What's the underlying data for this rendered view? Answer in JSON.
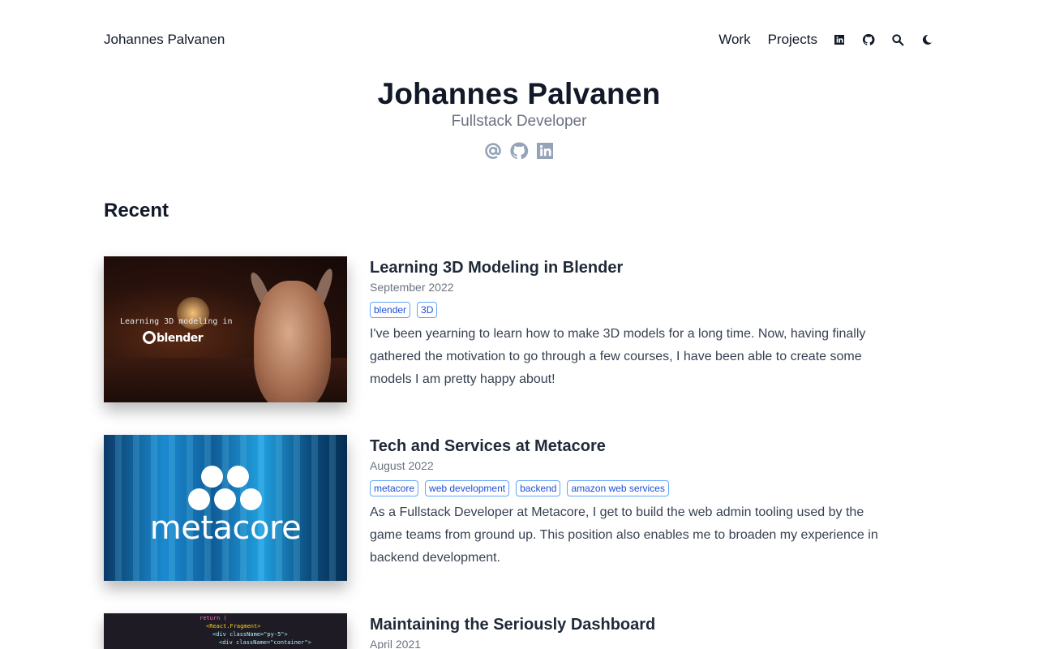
{
  "header": {
    "brand": "Johannes Palvanen",
    "nav": [
      {
        "label": "Work"
      },
      {
        "label": "Projects"
      }
    ],
    "icons": [
      "linkedin-icon",
      "github-icon",
      "search-icon",
      "moon-icon"
    ]
  },
  "hero": {
    "name": "Johannes Palvanen",
    "role": "Fullstack Developer",
    "social_icons": [
      "at-sign-icon",
      "github-icon",
      "linkedin-icon"
    ]
  },
  "recent": {
    "title": "Recent",
    "posts": [
      {
        "title": "Learning 3D Modeling in Blender",
        "date": "September 2022",
        "tags": [
          "blender",
          "3D"
        ],
        "excerpt": "I've been yearning to learn how to make 3D models for a long time. Now, having finally gathered the motivation to go through a few courses, I have been able to create some models I am pretty happy about!",
        "thumb_caption": "Learning 3D modeling in",
        "thumb_logo": "blender"
      },
      {
        "title": "Tech and Services at Metacore",
        "date": "August 2022",
        "tags": [
          "metacore",
          "web development",
          "backend",
          "amazon web services"
        ],
        "excerpt": "As a Fullstack Developer at Metacore, I get to build the web admin tooling used by the game teams from ground up. This position also enables me to broaden my experience in backend development.",
        "thumb_logo": "metacore"
      },
      {
        "title": "Maintaining the Seriously Dashboard",
        "date": "April 2021",
        "thumb_code": [
          "return (",
          "<React.Fragment>",
          "<div className=\"py-5\">",
          "<div className=\"container\">"
        ]
      }
    ]
  },
  "colors": {
    "text": "#111827",
    "muted": "#6b7280",
    "tag_text": "#1d4ed8",
    "tag_border": "#60a5fa",
    "social_icon": "#94a3b8"
  }
}
